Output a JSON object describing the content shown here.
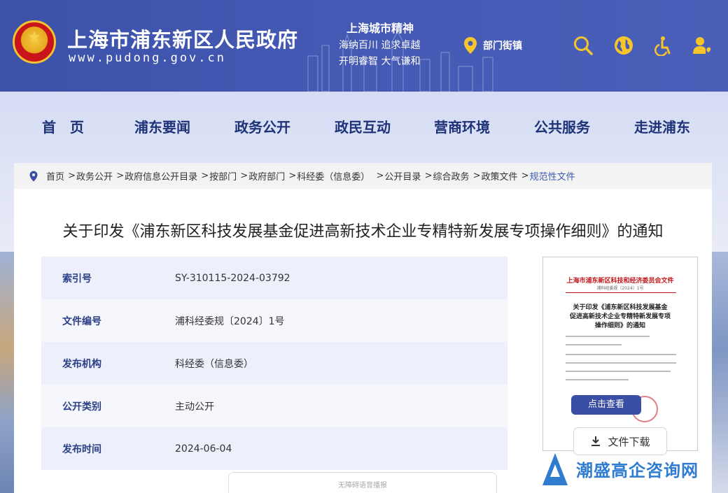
{
  "header": {
    "site_title": "上海市浦东新区人民政府",
    "site_url": "www.pudong.gov.cn",
    "spirit_title": "上海城市精神",
    "spirit_line1": "海纳百川  追求卓越",
    "spirit_line2": "开明睿智  大气谦和",
    "dept_link": "部门街镇",
    "icons": [
      "search-icon",
      "globe-icon",
      "accessibility-icon",
      "user-icon"
    ],
    "colors": {
      "header_bg": "#4459b4",
      "accent_yellow": "#f6c52c"
    }
  },
  "nav": {
    "items": [
      "首　页",
      "浦东要闻",
      "政务公开",
      "政民互动",
      "营商环境",
      "公共服务",
      "走进浦东"
    ],
    "color": "#1e3277"
  },
  "breadcrumb": {
    "items": [
      "首页",
      "政务公开",
      "政府信息公开目录",
      "按部门",
      "政府部门",
      "科经委（信息委）",
      "公开目录",
      "综合政务",
      "政策文件",
      "规范性文件"
    ]
  },
  "document": {
    "title": "关于印发《浦东新区科技发展基金促进高新技术企业专精特新发展专项操作细则》的通知",
    "fields": [
      {
        "label": "索引号",
        "value": "SY-310115-2024-03792"
      },
      {
        "label": "文件编号",
        "value": "浦科经委规〔2024〕1号"
      },
      {
        "label": "发布机构",
        "value": "科经委（信息委）"
      },
      {
        "label": "公开类别",
        "value": "主动公开"
      },
      {
        "label": "发布时间",
        "value": "2024-06-04"
      }
    ]
  },
  "reader_bar": "无障碍语音播报",
  "preview": {
    "header": "上海市浦东新区科技和经济委员会文件",
    "doc_no": "浦科经委规〔2024〕1号",
    "title_line1": "关于印发《浦东新区科技发展基金",
    "title_line2": "促进高新技术企业专精特新发展专项",
    "title_line3": "操作细则》的通知",
    "view_button": "点击查看",
    "download_button": "文件下载"
  },
  "watermark": {
    "text": "潮盛高企咨询网"
  }
}
